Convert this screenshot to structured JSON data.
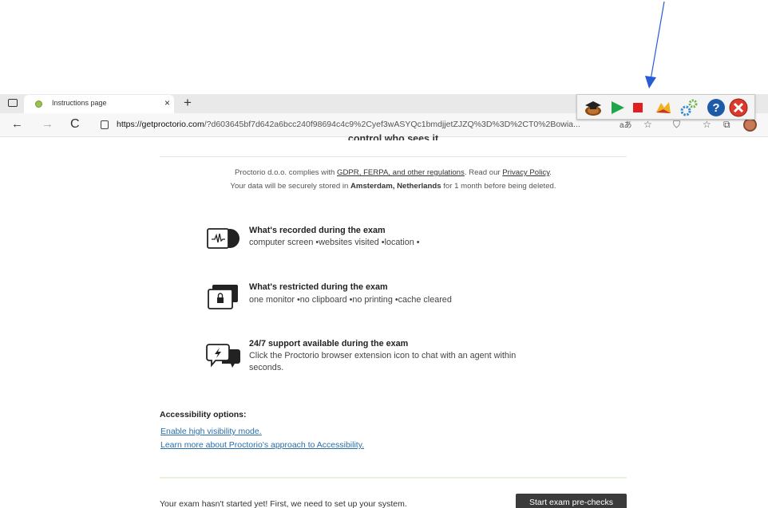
{
  "browser": {
    "tab_title": "Instructions page",
    "tab_close": "×",
    "new_tab": "+",
    "url_host": "https://getproctorio.com",
    "url_rest": "/?d603645bf7d642a6bcc240f98694c4c9%2Cyef3wASYQc1bmdjjetZJZQ%3D%3D%2CT0%2Bowia...",
    "nav_back": "←",
    "nav_forward": "→",
    "nav_refresh": "C"
  },
  "extension_toolbar": {
    "icons": [
      "proctorio-hat-icon",
      "play-icon",
      "stop-icon",
      "bird-icon",
      "gears-icon",
      "help-icon",
      "close-icon"
    ],
    "colors": {
      "play": "#1fa64a",
      "stop": "#e02020",
      "help": "#1d5aa8",
      "close": "#d93a2b"
    }
  },
  "page": {
    "cut_heading": "control who sees it",
    "compliance": {
      "prefix": "Proctorio d.o.o. complies with ",
      "regs_link": "GDPR, FERPA, and other regulations",
      "mid": ". Read our ",
      "policy_link": "Privacy Policy",
      "suffix": "."
    },
    "storage": {
      "prefix": "Your data will be securely stored in ",
      "location": "Amsterdam, Netherlands",
      "suffix": " for 1 month before being deleted."
    },
    "features": [
      {
        "title": "What's recorded during the exam",
        "desc": "computer screen •websites visited •location •"
      },
      {
        "title": "What's restricted during the exam",
        "desc": "one monitor •no clipboard •no printing •cache cleared"
      },
      {
        "title": "24/7 support available during the exam",
        "desc_line1": "Click the Proctorio browser extension icon to chat with an agent within",
        "desc_line2": "seconds."
      }
    ],
    "accessibility": {
      "title": "Accessibility options:",
      "link_visibility": "Enable high visibility mode",
      "link_visibility_suffix": ".",
      "link_learn": "Learn more about Proctorio's approach to Accessibility",
      "link_learn_suffix": "."
    },
    "footer": {
      "status": "Your exam hasn't started yet! First, we need to set up your system.",
      "start_button": "Start exam pre-checks"
    }
  },
  "colors": {
    "link": "#2a6ea8",
    "button_bg": "#3b3b3b",
    "accent_line": "#e8f3dc",
    "annotation_arrow": "#2a5bd7"
  }
}
